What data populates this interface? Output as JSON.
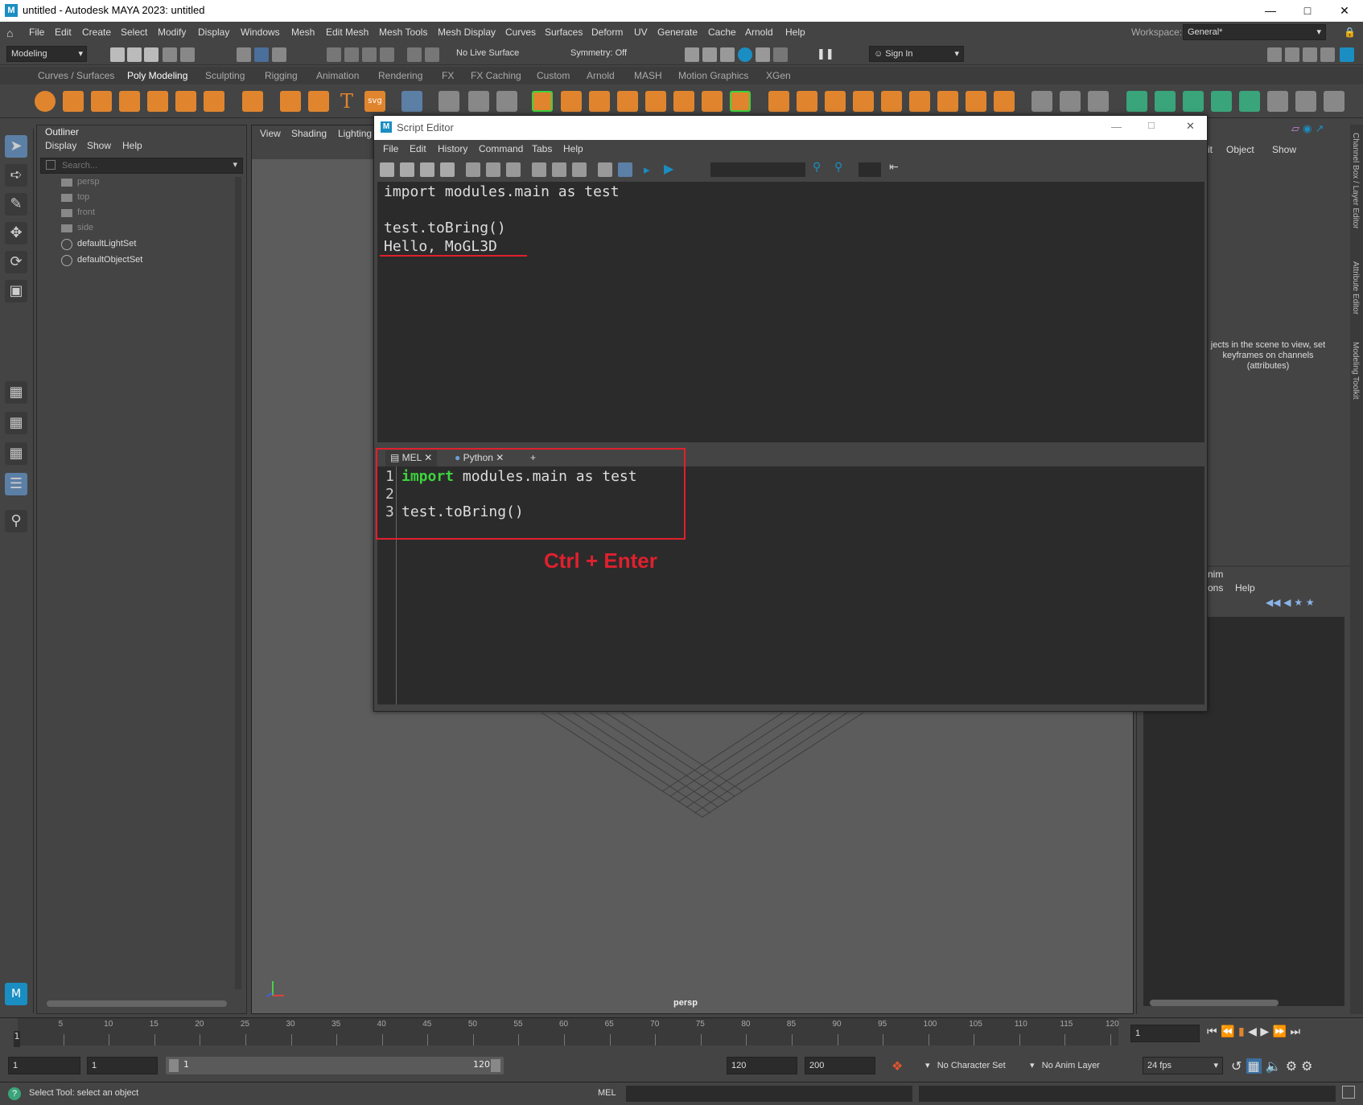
{
  "window": {
    "title": "untitled - Autodesk MAYA 2023: untitled",
    "logo": "M"
  },
  "menubar": [
    "File",
    "Edit",
    "Create",
    "Select",
    "Modify",
    "Display",
    "Windows",
    "Mesh",
    "Edit Mesh",
    "Mesh Tools",
    "Mesh Display",
    "Curves",
    "Surfaces",
    "Deform",
    "UV",
    "Generate",
    "Cache",
    "Arnold",
    "Help"
  ],
  "workspace": {
    "label": "Workspace:",
    "value": "General*"
  },
  "statusline": {
    "mode": "Modeling",
    "live_surface": "No Live Surface",
    "symmetry": "Symmetry: Off",
    "sign_in": "Sign In"
  },
  "shelf_tabs": [
    "Curves / Surfaces",
    "Poly Modeling",
    "Sculpting",
    "Rigging",
    "Animation",
    "Rendering",
    "FX",
    "FX Caching",
    "Custom",
    "Arnold",
    "MASH",
    "Motion Graphics",
    "XGen"
  ],
  "outliner": {
    "title": "Outliner",
    "menu": [
      "Display",
      "Show",
      "Help"
    ],
    "search_placeholder": "Search...",
    "items": [
      {
        "label": "persp",
        "kind": "camera"
      },
      {
        "label": "top",
        "kind": "camera"
      },
      {
        "label": "front",
        "kind": "camera"
      },
      {
        "label": "side",
        "kind": "camera"
      },
      {
        "label": "defaultLightSet",
        "kind": "set"
      },
      {
        "label": "defaultObjectSet",
        "kind": "set"
      }
    ]
  },
  "viewport": {
    "menu": [
      "View",
      "Shading",
      "Lighting"
    ],
    "camera_label": "persp"
  },
  "channel_box": {
    "menu": [
      "it",
      "Object",
      "Show"
    ],
    "message": "jects in the scene to view, set keyframes on channels (attributes)",
    "layer_menu": [
      "nim",
      "ons",
      "Help"
    ],
    "side_tabs": [
      "Channel Box / Layer Editor",
      "Attribute Editor",
      "Modeling Toolkit"
    ]
  },
  "script_editor": {
    "title": "Script Editor",
    "menu": [
      "File",
      "Edit",
      "History",
      "Command",
      "Tabs",
      "Help"
    ],
    "history": [
      "import modules.main as test",
      "",
      "test.toBring()",
      "Hello, MoGL3D"
    ],
    "tabs": [
      "MEL",
      "Python",
      "+"
    ],
    "input_lines": [
      {
        "num": "1",
        "keyword": "import",
        "rest": " modules.main as test"
      },
      {
        "num": "2",
        "keyword": "",
        "rest": ""
      },
      {
        "num": "3",
        "keyword": "",
        "rest": "test.toBring()"
      }
    ],
    "annotation": "Ctrl + Enter"
  },
  "timeline": {
    "ticks": [
      "5",
      "10",
      "15",
      "20",
      "25",
      "30",
      "35",
      "40",
      "45",
      "50",
      "55",
      "60",
      "65",
      "70",
      "75",
      "80",
      "85",
      "90",
      "95",
      "100",
      "105",
      "110",
      "115",
      "120"
    ],
    "current_frame_marker": "1",
    "current_frame": "1"
  },
  "range": {
    "start": "1",
    "range_start": "1",
    "slider_start": "1",
    "slider_end": "120",
    "end": "120",
    "anim_end": "200",
    "character_set": "No Character Set",
    "anim_layer": "No Anim Layer",
    "fps": "24 fps"
  },
  "command_line": {
    "help_text": "Select Tool: select an object",
    "mode": "MEL"
  },
  "colors": {
    "annotation_red": "#e0202e",
    "keyword_green": "#3dd33d",
    "panel_bg": "#444444",
    "editor_bg": "#2b2b2b",
    "accent_blue": "#1a8ec2"
  }
}
